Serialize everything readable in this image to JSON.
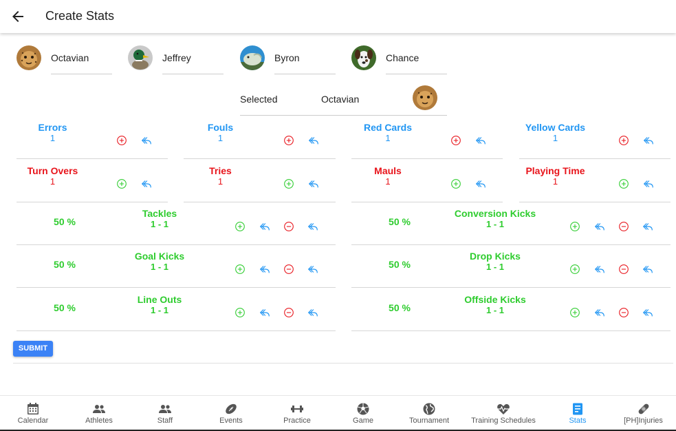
{
  "header": {
    "title": "Create Stats"
  },
  "athletes": [
    {
      "name": "Octavian"
    },
    {
      "name": "Jeffrey"
    },
    {
      "name": "Byron"
    },
    {
      "name": "Chance"
    }
  ],
  "selected": {
    "label": "Selected",
    "value": "Octavian"
  },
  "simple_stats": [
    {
      "name": "Errors",
      "value": "1",
      "color": "#2196f3"
    },
    {
      "name": "Fouls",
      "value": "1",
      "color": "#2196f3"
    },
    {
      "name": "Red Cards",
      "value": "1",
      "color": "#2196f3"
    },
    {
      "name": "Yellow Cards",
      "value": "1",
      "color": "#2196f3"
    },
    {
      "name": "Turn Overs",
      "value": "1",
      "color": "#e8141b"
    },
    {
      "name": "Tries",
      "value": "1",
      "color": "#e8141b"
    },
    {
      "name": "Mauls",
      "value": "1",
      "color": "#e8141b"
    },
    {
      "name": "Playing Time",
      "value": "1",
      "color": "#e8141b"
    }
  ],
  "ratio_stats": [
    {
      "name": "Tackles",
      "value": "1 - 1",
      "percent": "50 %"
    },
    {
      "name": "Conversion Kicks",
      "value": "1 - 1",
      "percent": "50 %"
    },
    {
      "name": "Goal Kicks",
      "value": "1 - 1",
      "percent": "50 %"
    },
    {
      "name": "Drop Kicks",
      "value": "1 - 1",
      "percent": "50 %"
    },
    {
      "name": "Line Outs",
      "value": "1 - 1",
      "percent": "50 %"
    },
    {
      "name": "Offside Kicks",
      "value": "1 - 1",
      "percent": "50 %"
    }
  ],
  "submit_label": "SUBMIT",
  "nav": [
    {
      "label": "Calendar",
      "icon": "calendar-icon",
      "active": false
    },
    {
      "label": "Athletes",
      "icon": "people-icon",
      "active": false
    },
    {
      "label": "Staff",
      "icon": "people-icon",
      "active": false
    },
    {
      "label": "Events",
      "icon": "football-icon",
      "active": false
    },
    {
      "label": "Practice",
      "icon": "dumbbell-icon",
      "active": false
    },
    {
      "label": "Game",
      "icon": "soccer-ball-icon",
      "active": false
    },
    {
      "label": "Tournament",
      "icon": "globe-icon",
      "active": false
    },
    {
      "label": "Training Schedules",
      "icon": "heart-monitor-icon",
      "active": false
    },
    {
      "label": "Stats",
      "icon": "stats-document-icon",
      "active": true
    },
    {
      "label": "[PH]Injuries",
      "icon": "bandage-icon",
      "active": false
    }
  ],
  "colors": {
    "blue": "#2196f3",
    "red": "#e8141b",
    "green": "#2ecc2e",
    "accent": "#3b82f6"
  }
}
